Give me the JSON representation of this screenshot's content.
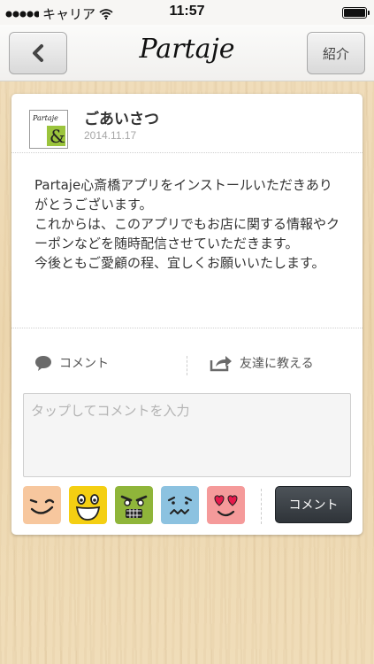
{
  "status": {
    "carrier": "キャリア",
    "time": "11:57"
  },
  "nav": {
    "title": "Partaje",
    "back_icon": "chevron-left-icon",
    "intro_label": "紹介"
  },
  "post": {
    "avatar_text": "Partaje",
    "title": "ごあいさつ",
    "date": "2014.11.17",
    "body": "Partaje心斎橋アプリをインストールいただきありがとうございます。\nこれからは、このアプリでもお店に関する情報やクーポンなどを随時配信させていただきます。\n今後ともご愛顧の程、宜しくお願いいたします。"
  },
  "actions": {
    "comment_label": "コメント",
    "share_label": "友達に教える"
  },
  "comment_input": {
    "placeholder": "タップしてコメントを入力"
  },
  "stamps": [
    "wink-face-icon",
    "laughing-face-icon",
    "scary-face-icon",
    "worried-face-icon",
    "heart-eyes-face-icon"
  ],
  "send_label": "コメント"
}
